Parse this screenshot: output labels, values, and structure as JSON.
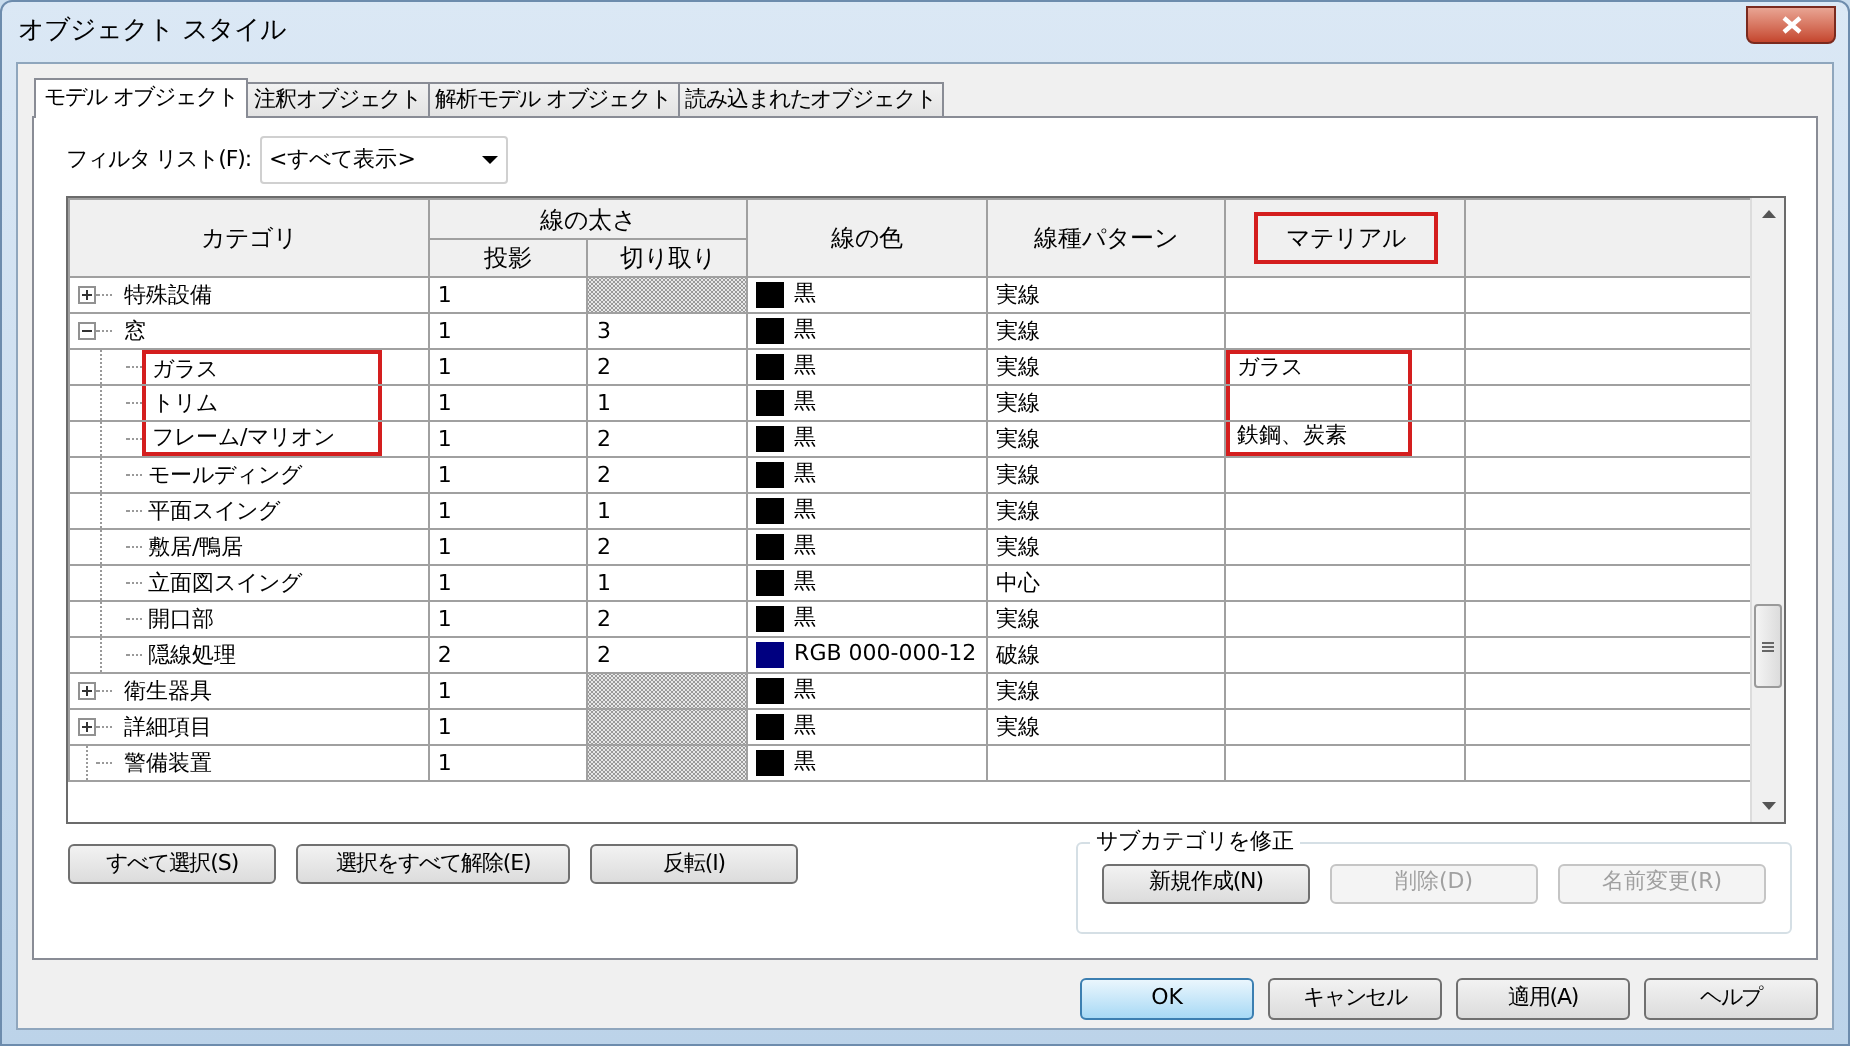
{
  "window": {
    "title": "オブジェクト スタイル"
  },
  "tabs": [
    {
      "label": "モデル オブジェクト",
      "selected": true
    },
    {
      "label": "注釈オブジェクト",
      "selected": false
    },
    {
      "label": "解析モデル オブジェクト",
      "selected": false
    },
    {
      "label": "読み込まれたオブジェクト",
      "selected": false
    }
  ],
  "filter": {
    "label": "フィルタ リスト(F):",
    "value": "<すべて表示>"
  },
  "table": {
    "columns": {
      "category": "カテゴリ",
      "line_weight": "線の太さ",
      "projection": "投影",
      "cut": "切り取り",
      "line_color": "線の色",
      "line_pattern": "線種パターン",
      "material": "マテリアル"
    },
    "material_header_highlighted": true,
    "rows": [
      {
        "category": "特殊設備",
        "expanded": false,
        "projection": "1",
        "color_name": "黒",
        "color": "#000000",
        "pattern": "実線"
      },
      {
        "category": "窓",
        "expanded": true,
        "projection": "1",
        "cut": "3",
        "color_name": "黒",
        "color": "#000000",
        "pattern": "実線",
        "children": [
          {
            "category": "ガラス",
            "highlighted": true,
            "projection": "1",
            "cut": "2",
            "color_name": "黒",
            "color": "#000000",
            "pattern": "実線",
            "material": "ガラス"
          },
          {
            "category": "トリム",
            "highlighted": true,
            "projection": "1",
            "cut": "1",
            "color_name": "黒",
            "color": "#000000",
            "pattern": "実線"
          },
          {
            "category": "フレーム/マリオン",
            "highlighted": true,
            "projection": "1",
            "cut": "2",
            "color_name": "黒",
            "color": "#000000",
            "pattern": "実線",
            "material": "鉄鋼、炭素"
          },
          {
            "category": "モールディング",
            "projection": "1",
            "cut": "2",
            "color_name": "黒",
            "color": "#000000",
            "pattern": "実線"
          },
          {
            "category": "平面スイング",
            "projection": "1",
            "cut": "1",
            "color_name": "黒",
            "color": "#000000",
            "pattern": "実線"
          },
          {
            "category": "敷居/鴨居",
            "projection": "1",
            "cut": "2",
            "color_name": "黒",
            "color": "#000000",
            "pattern": "実線"
          },
          {
            "category": "立面図スイング",
            "projection": "1",
            "cut": "1",
            "color_name": "黒",
            "color": "#000000",
            "pattern": "中心"
          },
          {
            "category": "開口部",
            "projection": "1",
            "cut": "2",
            "color_name": "黒",
            "color": "#000000",
            "pattern": "実線"
          },
          {
            "category": "隠線処理",
            "projection": "2",
            "cut": "2",
            "color_name": "RGB 000-000-12",
            "color": "#000080",
            "pattern": "破線"
          }
        ]
      },
      {
        "category": "衛生器具",
        "expanded": false,
        "projection": "1",
        "color_name": "黒",
        "color": "#000000",
        "pattern": "実線"
      },
      {
        "category": "詳細項目",
        "expanded": false,
        "projection": "1",
        "color_name": "黒",
        "color": "#000000",
        "pattern": "実線"
      },
      {
        "category": "警備装置",
        "projection": "1",
        "color_name": "黒",
        "color": "#000000"
      }
    ]
  },
  "selection_buttons": [
    "すべて選択(S)",
    "選択をすべて解除(E)",
    "反転(I)"
  ],
  "subcategory": {
    "title": "サブカテゴリを修正",
    "buttons": [
      {
        "label": "新規作成(N)",
        "disabled": false
      },
      {
        "label": "削除(D)",
        "disabled": true
      },
      {
        "label": "名前変更(R)",
        "disabled": true
      }
    ]
  },
  "dialog_buttons": [
    {
      "label": "OK",
      "default": true
    },
    {
      "label": "キャンセル",
      "default": false
    },
    {
      "label": "適用(A)",
      "default": false
    },
    {
      "label": "ヘルプ",
      "default": false
    }
  ]
}
